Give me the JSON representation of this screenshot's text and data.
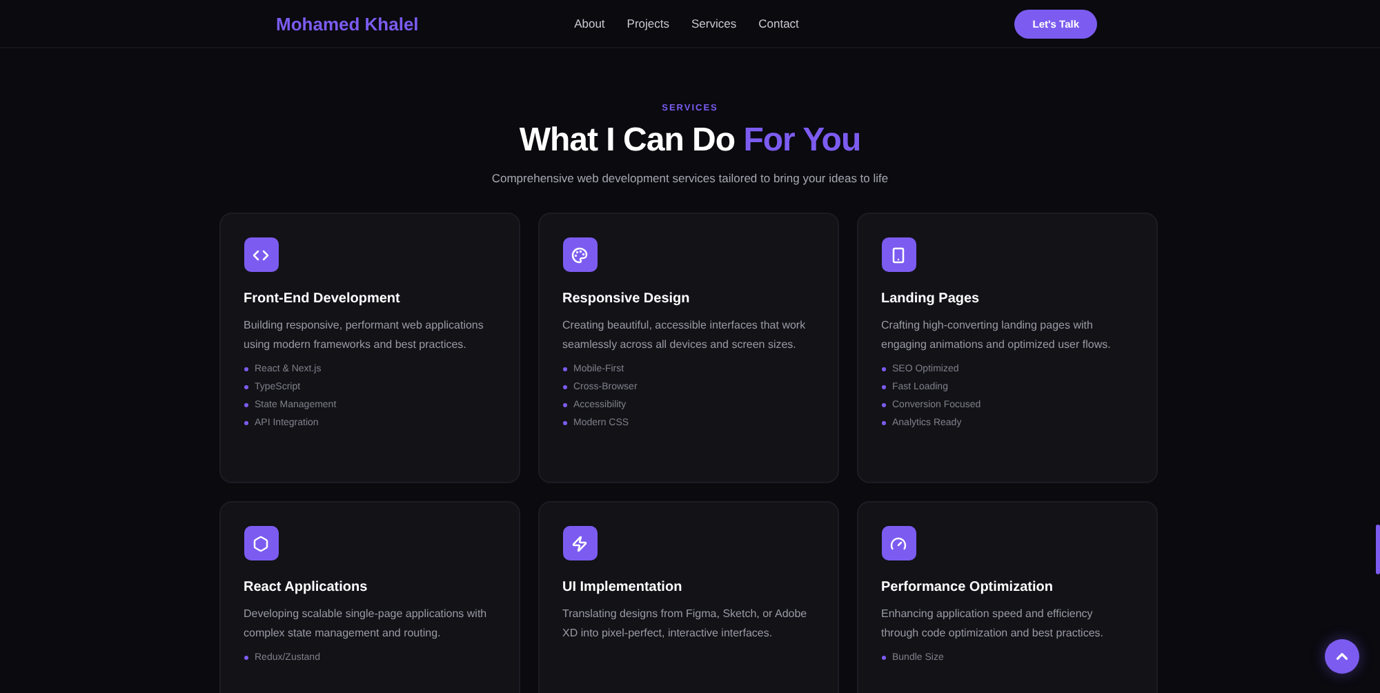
{
  "header": {
    "logo": "Mohamed Khalel",
    "nav": [
      "About",
      "Projects",
      "Services",
      "Contact"
    ],
    "cta": "Let's Talk"
  },
  "section": {
    "eyebrow": "SERVICES",
    "title_start": "What I Can Do",
    "title_accent": "For You",
    "subtitle": "Comprehensive web development services tailored to bring your ideas to life"
  },
  "cards": [
    {
      "title": "Front-End Development",
      "description": "Building responsive, performant web applications using modern frameworks and best practices.",
      "features": [
        "React & Next.js",
        "TypeScript",
        "State Management",
        "API Integration"
      ]
    },
    {
      "title": "Responsive Design",
      "description": "Creating beautiful, accessible interfaces that work seamlessly across all devices and screen sizes.",
      "features": [
        "Mobile-First",
        "Cross-Browser",
        "Accessibility",
        "Modern CSS"
      ]
    },
    {
      "title": "Landing Pages",
      "description": "Crafting high-converting landing pages with engaging animations and optimized user flows.",
      "features": [
        "SEO Optimized",
        "Fast Loading",
        "Conversion Focused",
        "Analytics Ready"
      ]
    },
    {
      "title": "React Applications",
      "description": "Developing scalable single-page applications with complex state management and routing.",
      "features": [
        "Redux/Zustand"
      ]
    },
    {
      "title": "UI Implementation",
      "description": "Translating designs from Figma, Sketch, or Adobe XD into pixel-perfect, interactive interfaces."
    },
    {
      "title": "Performance Optimization",
      "description": "Enhancing application speed and efficiency through code optimization and best practices.",
      "features": [
        "Bundle Size"
      ]
    }
  ]
}
